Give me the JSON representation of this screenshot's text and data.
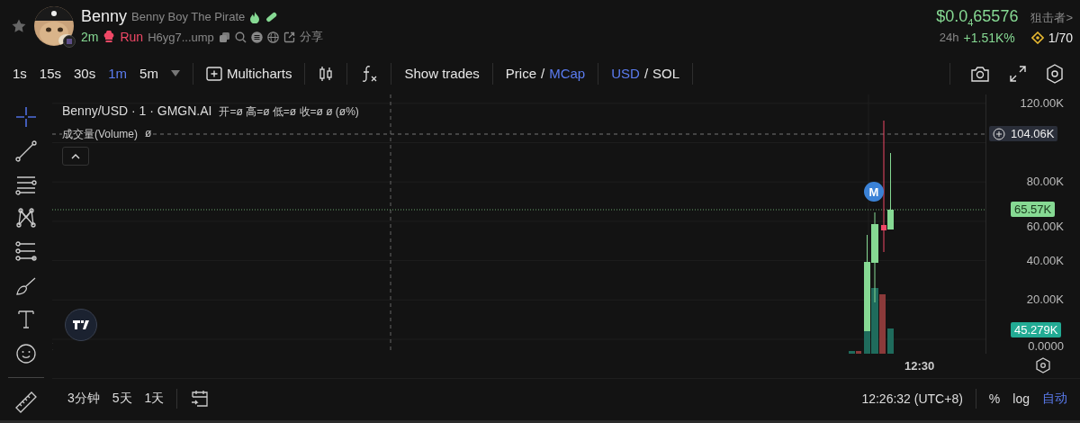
{
  "token": {
    "symbol": "Benny",
    "name": "Benny Boy The Pirate",
    "age": "2m",
    "status": "Run",
    "address": "H6yg7...ump",
    "share": "分享"
  },
  "price": {
    "value": "$0.0$_{4}$65576",
    "period": "24h",
    "change": "+1.51K%",
    "sniper": "狙击者>",
    "rank": "1/70"
  },
  "toolbar": {
    "intervals": [
      {
        "label": "1s",
        "selected": false
      },
      {
        "label": "15s",
        "selected": false
      },
      {
        "label": "30s",
        "selected": false
      },
      {
        "label": "1m",
        "selected": true
      },
      {
        "label": "5m",
        "selected": false
      }
    ],
    "multicharts": "Multicharts",
    "show_trades": "Show trades",
    "price_mode": {
      "separator": "/",
      "options": [
        {
          "label": "Price",
          "selected": false
        },
        {
          "label": "MCap",
          "selected": true
        }
      ]
    },
    "currency": {
      "separator": "/",
      "options": [
        {
          "label": "USD",
          "selected": true
        },
        {
          "label": "SOL",
          "selected": false
        }
      ]
    }
  },
  "chart": {
    "legend": "Benny/USD · 1 · GMGN.AI",
    "ohlc": "开=ø 高=ø 低=ø 收=ø ø (ø%)",
    "volume_label": "成交量(Volume)",
    "volume_value": "ø",
    "marker": "M",
    "y_ticks": [
      "120.00K",
      "80.00K",
      "60.00K",
      "40.00K",
      "20.00K",
      "0.0000"
    ],
    "crosshair_price": "104.06K",
    "last_price": "65.57K",
    "volume_badge": "45.279K",
    "time_tick": "12:30"
  },
  "bottom": {
    "ranges": [
      "3分钟",
      "5天",
      "1天"
    ],
    "time": "12:26:32 (UTC+8)",
    "scale": [
      {
        "label": "%",
        "selected": false
      },
      {
        "label": "log",
        "selected": false
      },
      {
        "label": "自动",
        "selected": true
      }
    ]
  }
}
